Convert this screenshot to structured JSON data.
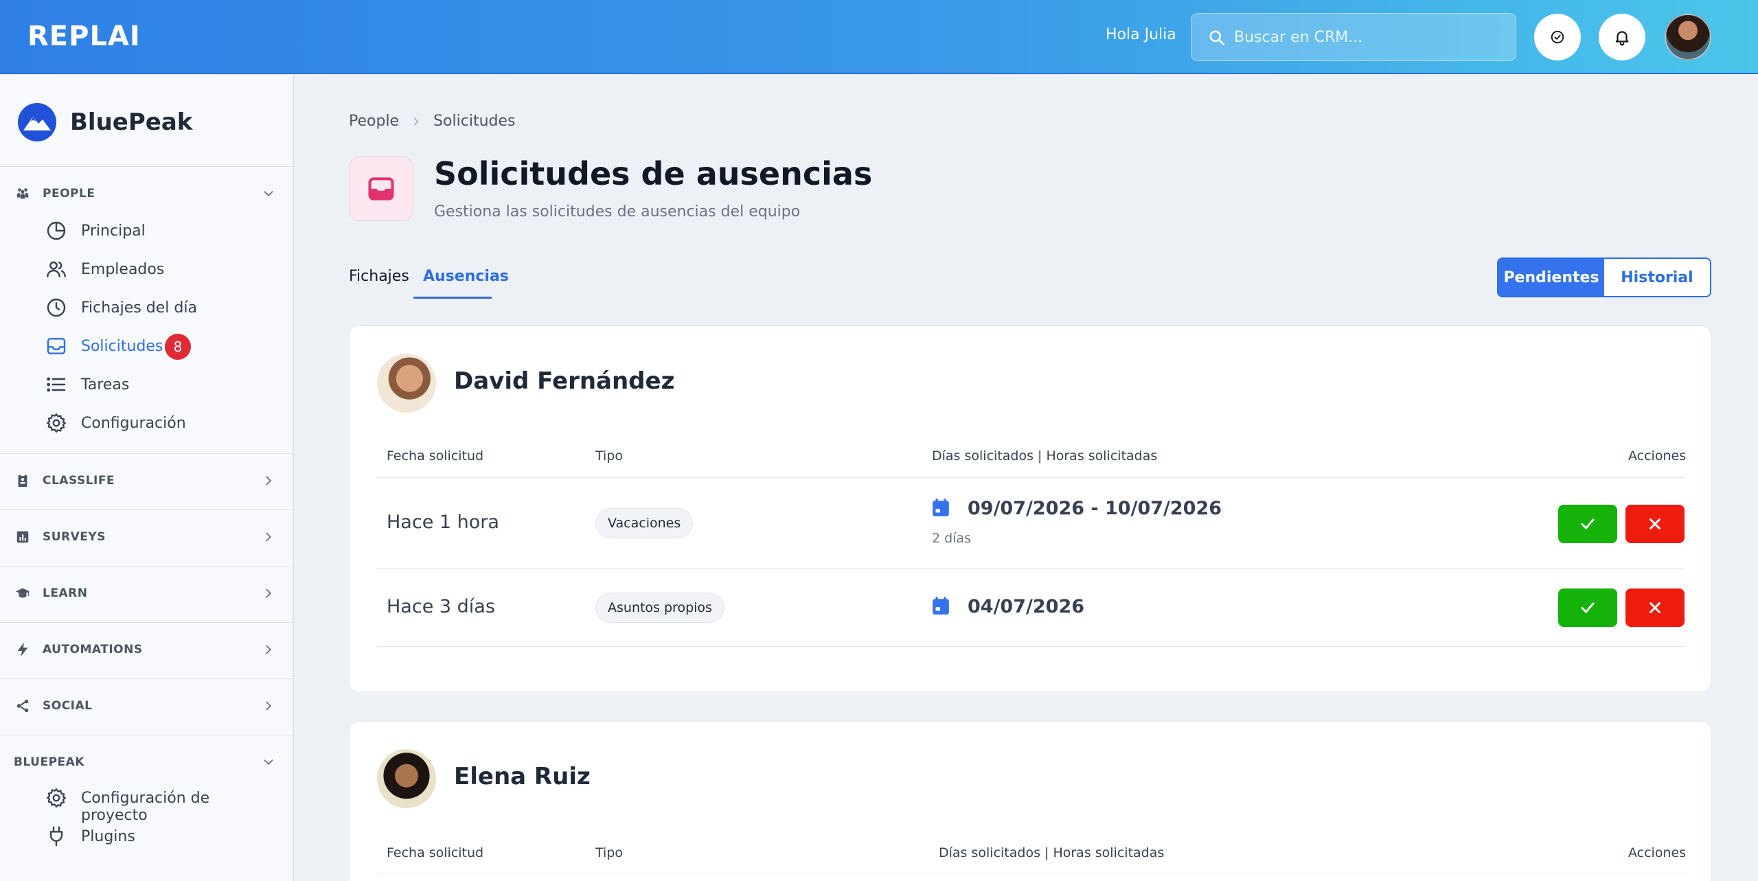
{
  "topbar": {
    "logo": "REPLAI",
    "greeting": "Hola Julia",
    "search_placeholder": "Buscar en CRM..."
  },
  "sidebar": {
    "brand": "BluePeak",
    "sections": [
      {
        "label": "PEOPLE",
        "icon": "people-icon",
        "expanded": true
      },
      {
        "label": "CLASSLIFE",
        "icon": "badge-icon",
        "expanded": false
      },
      {
        "label": "SURVEYS",
        "icon": "chart-icon",
        "expanded": false
      },
      {
        "label": "LEARN",
        "icon": "graduation-cap-icon",
        "expanded": false
      },
      {
        "label": "AUTOMATIONS",
        "icon": "bolt-icon",
        "expanded": false
      },
      {
        "label": "SOCIAL",
        "icon": "share-icon",
        "expanded": false
      },
      {
        "label": "BLUEPEAK",
        "icon": "",
        "expanded": true
      }
    ],
    "people_items": [
      {
        "label": "Principal",
        "icon": "pie-chart-icon"
      },
      {
        "label": "Empleados",
        "icon": "users-icon"
      },
      {
        "label": "Fichajes del día",
        "icon": "clock-icon"
      },
      {
        "label": "Solicitudes",
        "icon": "inbox-icon",
        "active": true,
        "badge": "8"
      },
      {
        "label": "Tareas",
        "icon": "list-icon"
      },
      {
        "label": "Configuración",
        "icon": "gear-icon"
      }
    ],
    "bluepeak_items": [
      {
        "label": "Configuración de proyecto",
        "icon": "gear-icon"
      },
      {
        "label": "Plugins",
        "icon": "plug-icon"
      }
    ]
  },
  "main": {
    "breadcrumb": [
      "People",
      "Solicitudes"
    ],
    "title": "Solicitudes de ausencias",
    "subtitle": "Gestiona las solicitudes de ausencias del equipo",
    "tabs": [
      {
        "label": "Fichajes"
      },
      {
        "label": "Ausencias",
        "active": true
      }
    ],
    "filters": [
      {
        "label": "Pendientes",
        "active": true
      },
      {
        "label": "Historial"
      }
    ],
    "columns": [
      "Fecha solicitud",
      "Tipo",
      "Días solicitados | Horas solicitadas",
      "Acciones"
    ],
    "cards": [
      {
        "name": "David Fernández",
        "rows": [
          {
            "fecha": "Hace 1 hora",
            "tipo": "Vacaciones",
            "rango": "09/07/2026 - 10/07/2026",
            "dias": "2 días"
          },
          {
            "fecha": "Hace 3 días",
            "tipo": "Asuntos propios",
            "rango": "04/07/2026",
            "dias": ""
          }
        ]
      },
      {
        "name": "Elena Ruiz",
        "rows": []
      }
    ]
  },
  "colors": {
    "accent": "#2d6fe0",
    "approve": "#15b309",
    "reject": "#ee1c0e",
    "badge": "#e02a35"
  }
}
